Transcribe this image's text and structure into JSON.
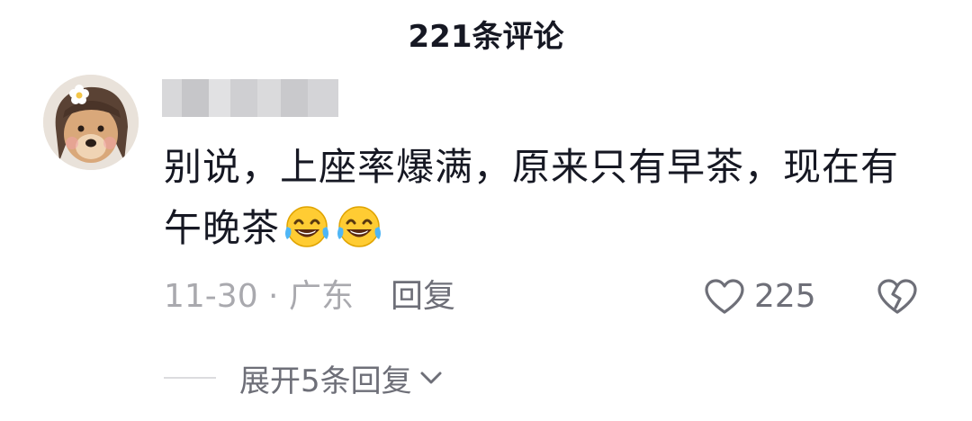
{
  "header": {
    "title": "221条评论"
  },
  "comment": {
    "text_line1": "别说，上座率爆满，原来只有早茶，现在有",
    "text_line2": "午晚茶",
    "emojis": [
      "laughing-tears-emoji",
      "laughing-tears-emoji"
    ],
    "time_location": "11-30 · 广东",
    "reply_label": "回复",
    "like_count": "225"
  },
  "replies": {
    "expand_label": "展开5条回复"
  },
  "icons": {
    "like": "heart-outline-icon",
    "dislike": "broken-heart-icon",
    "expand": "chevron-down-icon"
  },
  "colors": {
    "primary_text": "#161823",
    "secondary_text": "#a9a9ae",
    "action_text": "#6e6f78"
  }
}
